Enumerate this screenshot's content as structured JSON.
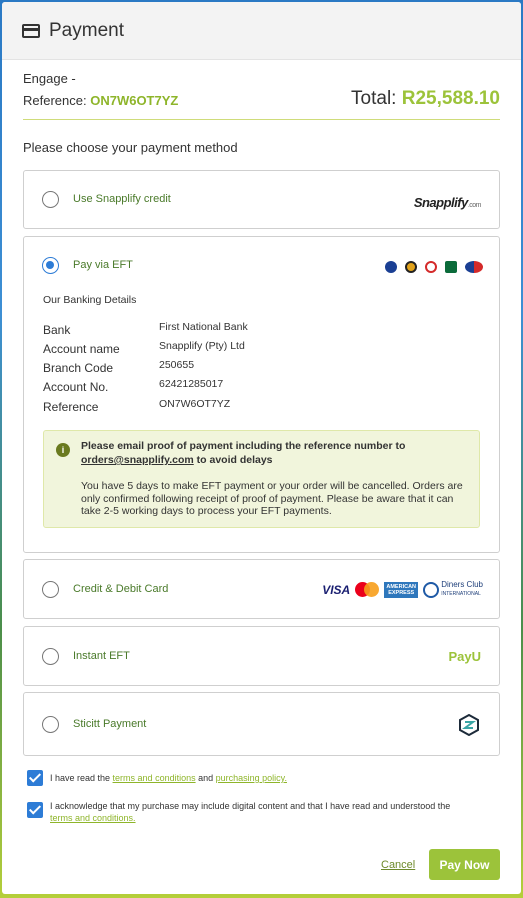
{
  "header": {
    "title": "Payment",
    "icon": "credit-card-icon"
  },
  "order": {
    "engage_label": "Engage -",
    "reference_label": "Reference:",
    "reference_code": "ON7W6OT7YZ",
    "total_label": "Total:",
    "total_amount": "R25,588.10"
  },
  "choose_text": "Please choose your payment method",
  "methods": {
    "snapplify": {
      "label": "Use Snapplify credit",
      "logo_text": "Snapplify",
      "logo_suffix": ".com",
      "selected": false
    },
    "eft": {
      "label": "Pay via EFT",
      "selected": true,
      "details_title": "Our Banking Details",
      "rows": [
        {
          "label": "Bank",
          "value": "First National Bank"
        },
        {
          "label": "Account name",
          "value": "Snapplify (Pty) Ltd"
        },
        {
          "label": "Branch Code",
          "value": "250655"
        },
        {
          "label": "Account No.",
          "value": "62421285017"
        },
        {
          "label": "Reference",
          "value": "ON7W6OT7YZ"
        }
      ],
      "notice": {
        "icon_text": "i",
        "bold_line1": "Please email proof of payment including the reference number to",
        "email": "orders@snapplify.com",
        "bold_line2_suffix": " to avoid delays",
        "paragraph": "You have 5 days to make EFT payment or your order will be cancelled. Orders are only confirmed following receipt of proof of payment. Please be aware that it can take 2-5 working days to process your EFT payments."
      }
    },
    "card": {
      "label": "Credit & Debit Card",
      "visa": "VISA",
      "amex": "AMERICAN EXPRESS",
      "diners_line1": "Diners Club",
      "diners_line2": "INTERNATIONAL",
      "selected": false
    },
    "instant_eft": {
      "label": "Instant EFT",
      "logo_text": "PayU",
      "selected": false
    },
    "sticitt": {
      "label": "Sticitt Payment",
      "selected": false
    }
  },
  "agreements": {
    "terms": {
      "prefix": "I have read the ",
      "terms_link": "terms and conditions",
      "middle": " and ",
      "policy_link": "purchasing policy.",
      "checked": true
    },
    "digital": {
      "text": "I acknowledge that my purchase may include digital content and that I have read and understood the",
      "link": "terms and conditions.",
      "checked": true
    }
  },
  "actions": {
    "cancel": "Cancel",
    "pay_now": "Pay Now"
  },
  "colors": {
    "accent_green": "#9cc33a",
    "link_green": "#8eb52a",
    "radio_blue": "#2d7cd6"
  }
}
